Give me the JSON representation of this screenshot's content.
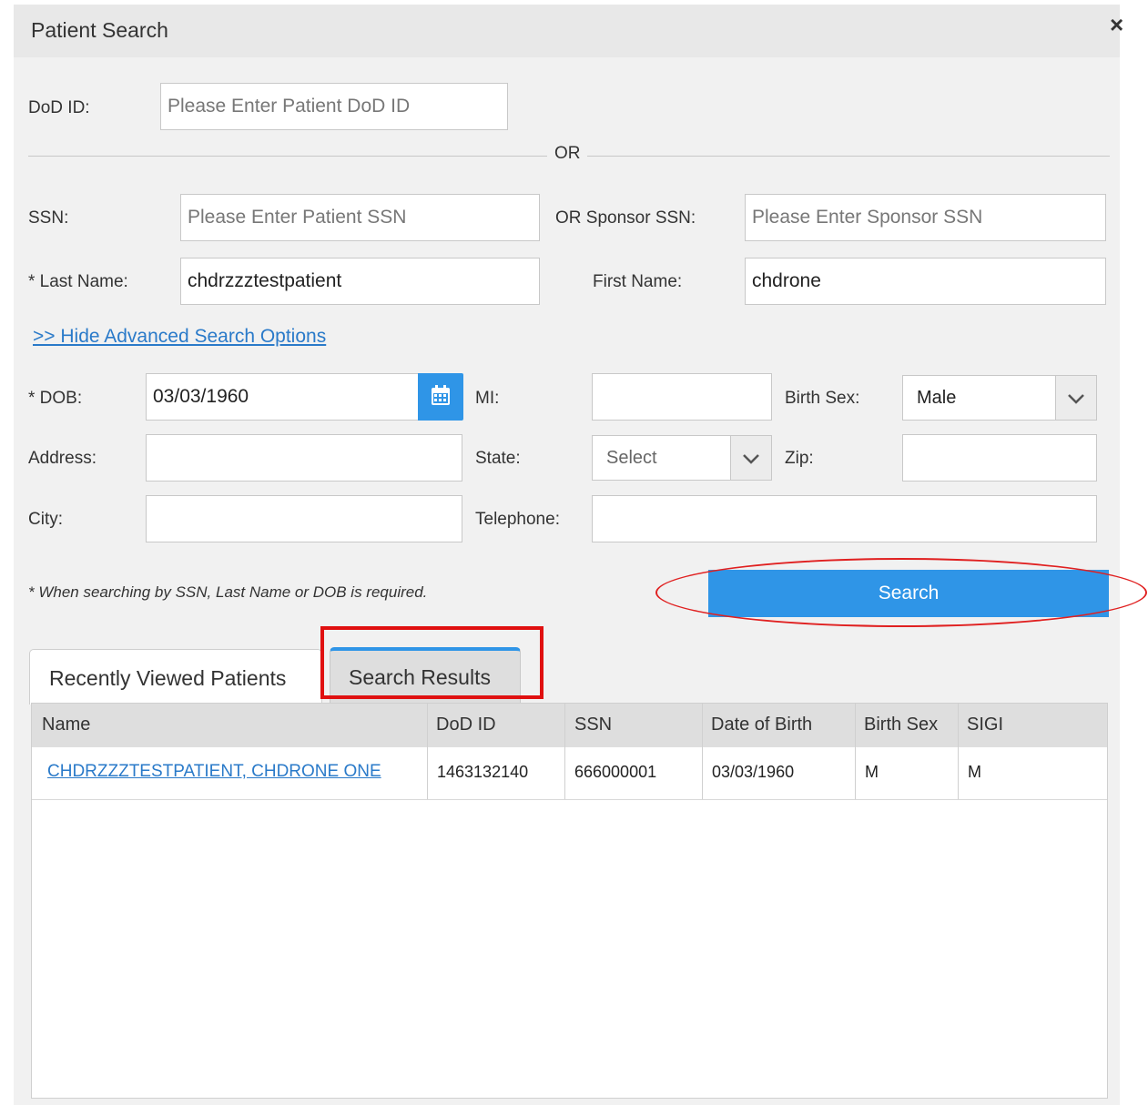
{
  "dialog": {
    "title": "Patient Search",
    "close_icon": "close-icon"
  },
  "labels": {
    "dod_id": "DoD ID:",
    "or": "OR",
    "ssn": "SSN:",
    "or_sponsor_ssn": "OR Sponsor SSN:",
    "last_name": "* Last Name:",
    "first_name": "First Name:",
    "dob": "* DOB:",
    "mi": "MI:",
    "birth_sex": "Birth Sex:",
    "address": "Address:",
    "state": "State:",
    "zip": "Zip:",
    "city": "City:",
    "telephone": "Telephone:"
  },
  "fields": {
    "dod_id": {
      "value": "",
      "placeholder": "Please Enter Patient DoD ID"
    },
    "ssn": {
      "value": "",
      "placeholder": "Please Enter Patient SSN"
    },
    "sponsor_ssn": {
      "value": "",
      "placeholder": "Please Enter Sponsor SSN"
    },
    "last_name": {
      "value": "chdrzzztestpatient",
      "placeholder": ""
    },
    "first_name": {
      "value": "chdrone",
      "placeholder": ""
    },
    "dob": {
      "value": "03/03/1960",
      "placeholder": ""
    },
    "mi": {
      "value": "",
      "placeholder": ""
    },
    "birth_sex": {
      "selected": "Male"
    },
    "address": {
      "value": "",
      "placeholder": ""
    },
    "state": {
      "selected": "Select"
    },
    "zip": {
      "value": "",
      "placeholder": ""
    },
    "city": {
      "value": "",
      "placeholder": ""
    },
    "telephone": {
      "value": "",
      "placeholder": ""
    }
  },
  "advanced_link": ">> Hide Advanced Search Options",
  "note": "* When searching by SSN, Last Name or DOB is required.",
  "search_button": "Search",
  "tabs": [
    {
      "label": "Recently Viewed Patients",
      "active": false
    },
    {
      "label": "Search Results",
      "active": true
    }
  ],
  "table": {
    "columns": [
      "Name",
      "DoD ID",
      "SSN",
      "Date of Birth",
      "Birth Sex",
      "SIGI"
    ],
    "rows": [
      [
        "CHDRZZZTESTPATIENT, CHDRONE ONE",
        "1463132140",
        "666000001",
        "03/03/1960",
        "M",
        "M"
      ]
    ]
  },
  "colors": {
    "accent": "#2f95e7",
    "annotation_red": "#e01010",
    "link": "#2a7ac9"
  }
}
